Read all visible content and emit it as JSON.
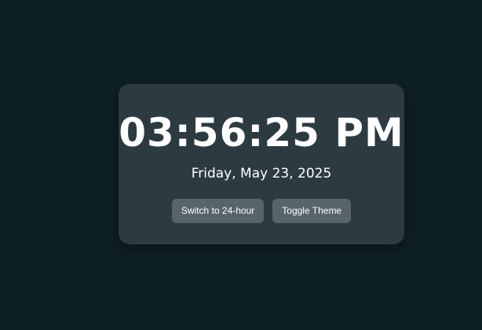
{
  "clock": {
    "time": "03:56:25 PM",
    "date": "Friday, May 23, 2025"
  },
  "controls": {
    "format_toggle_label": "Switch to 24-hour",
    "theme_toggle_label": "Toggle Theme"
  },
  "colors": {
    "background": "#0f1f26",
    "card": "#2c3a41",
    "button": "#57646b",
    "text": "#ffffff"
  }
}
